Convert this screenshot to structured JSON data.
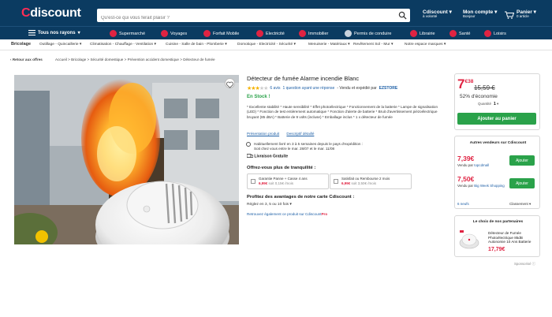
{
  "header": {
    "logo_c": "C",
    "logo_rest": "discount",
    "search_placeholder": "Qu'est-ce qui vous ferait plaisir ?",
    "cdiscount_link": "Cdiscount",
    "cdiscount_sub": "à volonté",
    "account_link": "Mon compte",
    "account_sub": "Bonjour",
    "cart_link": "Panier",
    "cart_sub": "0 article",
    "cart_count": "0"
  },
  "categories": [
    {
      "label": "Tous nos rayons",
      "icon": "menu-icon"
    },
    {
      "label": "Supermarché",
      "icon": "basket-icon"
    },
    {
      "label": "Voyages",
      "icon": "plane-icon"
    },
    {
      "label": "Forfait Mobile",
      "icon": "phone-icon"
    },
    {
      "label": "Electricité",
      "icon": "bolt-icon"
    },
    {
      "label": "Immobilier",
      "icon": "house-icon"
    },
    {
      "label": "Permis de conduire",
      "icon": "car-icon"
    },
    {
      "label": "Librairie",
      "icon": "book-icon"
    },
    {
      "label": "Santé",
      "icon": "health-icon"
    },
    {
      "label": "Loisirs",
      "icon": "leisure-icon"
    }
  ],
  "subnav": {
    "title": "Bricolage",
    "items": [
      "Outillage - Quincaillerie",
      "Climatisation - Chauffage - Ventilation",
      "Cuisine - Salle de bain - Plomberie",
      "Domotique - Electricité - Sécurité",
      "Menuiserie - Matériaux",
      "Revêtement Sol - Mur",
      "Notre espace marques"
    ]
  },
  "breadcrumb": {
    "back": "Retour aux offres",
    "items": [
      "Accueil",
      "Bricolage",
      "Sécurité domestique",
      "Prévention accident domestique",
      "Détecteur de fumée"
    ],
    "sep": ">"
  },
  "product": {
    "title": "Détecteur de fumée Alarme incendie Blanc",
    "rating_text": "6 avis",
    "question_link": "1 question ayant une réponse",
    "sold_by": "- Vendu et expédié par",
    "seller": "EZSTORE",
    "stock": "En Stock !",
    "description": "* Excellente stabilité * Haute sensibilité * Effet photoélectrique * Fonctionnement de la batterie * Lampe de signalisation (LED) * Fonction de test entièrement automatique * Fonction d'alerte de batterie * Bruit d'avertissement piézoélectrique bruyant (85 dBA) * Batterie de 9 volts (incluse) * Emballage inclus * 1 x détecteur de fumée",
    "link_presentation": "Présentation produit",
    "link_details": "Descriptif détaillé",
    "ship_line1": "Habituellement livré en 3 à 5 semaines depuis le pays d'expédition :",
    "ship_line2": "Soit chez vous entre le mar. 28/07 et le mar. 11/08",
    "free_delivery": "Livraison Gratuite",
    "tranquility_title": "Offrez-vous plus de tranquilité :",
    "warranty1_label": "Garantie Panne + Casse 4 ans",
    "warranty1_price": "6,99€",
    "warranty1_detail": "soit 0,15€ /mois",
    "warranty2_label": "Satisfait ou Rembourse 2 mois",
    "warranty2_price": "6,99€",
    "warranty2_detail": "soit 3,50€ /mois",
    "profit_title": "Profitez des avantages de notre carte Cdiscount :",
    "pay_text": "Réglez en 3, 5 ou 10 fois",
    "cpro_text": "Retrouvez également ce produit sur Cdiscount",
    "cpro_brand": "Pro"
  },
  "buybox": {
    "price_int": "7",
    "price_dec": "€38",
    "old_price": "15,59 €",
    "savings": "52% d'économie",
    "qty_label": "Quantité",
    "qty_value": "1",
    "add_to_cart": "Ajouter au panier"
  },
  "sellers": {
    "title": "Autres vendeurs sur Cdiscount",
    "offers": [
      {
        "price": "7,39€",
        "by_label": "Vendu par",
        "by": "topcdmall",
        "button": "Ajouter"
      },
      {
        "price": "7,50€",
        "by_label": "Vendu par",
        "by": "Big Week Shopping",
        "button": "Ajouter"
      }
    ],
    "count_link": "6 neufs",
    "sort_label": "Classement"
  },
  "partners": {
    "title": "Le choix de nos partenaires",
    "product_name": "Détecteur de Fumée Photoélectrique 85dB Autonomie 10 Ans Batterie",
    "product_price": "17,79€",
    "sponsored": "Sponsorisé"
  },
  "colors": {
    "brand": "#0b3b61",
    "accent": "#e02342",
    "green": "#2aa24a",
    "link": "#1d5fa6"
  },
  "rating_value": 3,
  "rating_max": 5
}
